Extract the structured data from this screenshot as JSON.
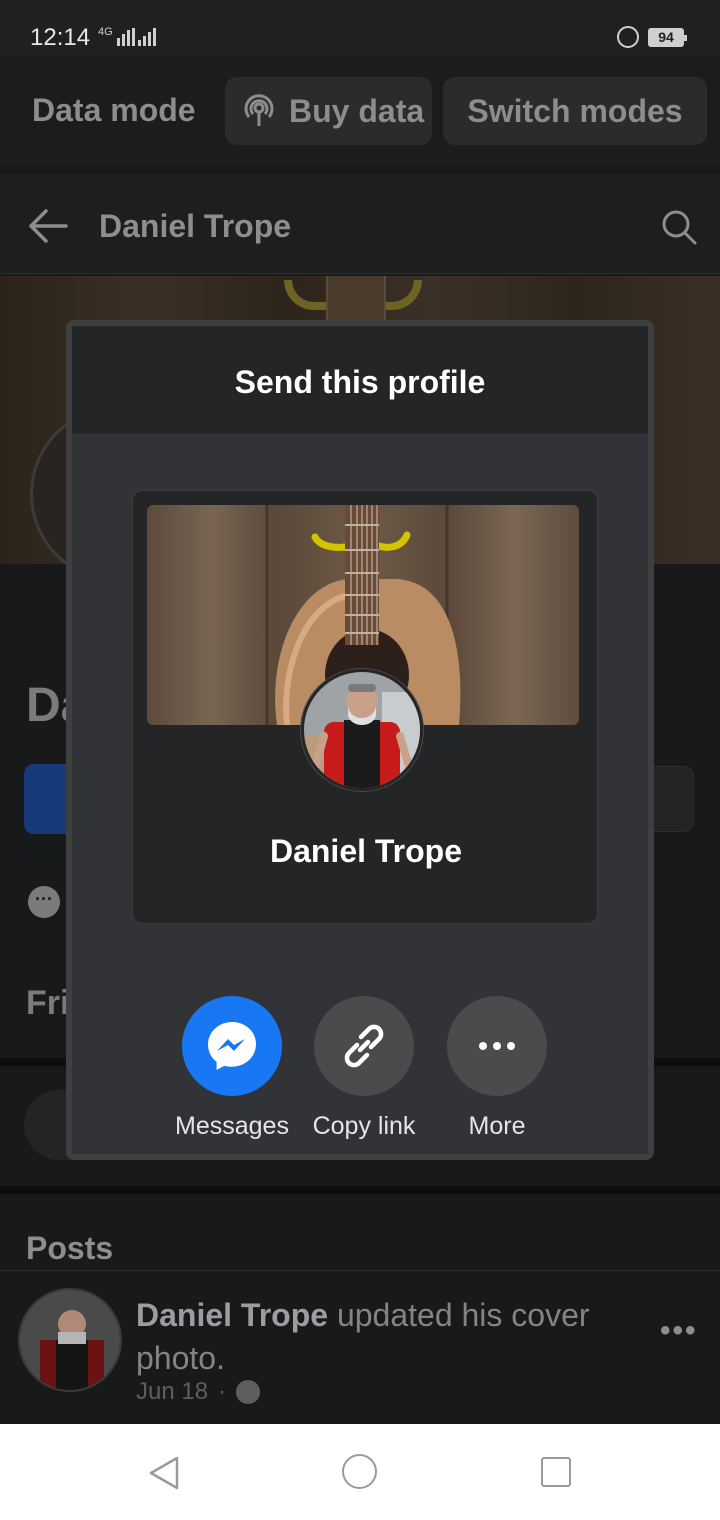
{
  "status_bar": {
    "time": "12:14",
    "network": "4G",
    "battery": "94"
  },
  "data_mode": {
    "label": "Data mode",
    "buy_label": "Buy data",
    "switch_label": "Switch modes"
  },
  "header": {
    "title": "Daniel Trope"
  },
  "profile_bg": {
    "name_partial": "Da",
    "friends_partial": "Fri"
  },
  "modal": {
    "title": "Send this profile",
    "card_name": "Daniel Trope",
    "actions": [
      {
        "label": "Messages",
        "icon": "messenger-icon"
      },
      {
        "label": "Copy link",
        "icon": "link-icon"
      },
      {
        "label": "More",
        "icon": "more-dots-icon"
      }
    ]
  },
  "posts": {
    "title": "Posts",
    "item": {
      "author": "Daniel Trope",
      "text": " updated his cover photo.",
      "date": "Jun 18",
      "separator": "·"
    }
  },
  "colors": {
    "accent": "#1877f2",
    "modal_bg": "#323336",
    "card_bg": "#242526"
  }
}
